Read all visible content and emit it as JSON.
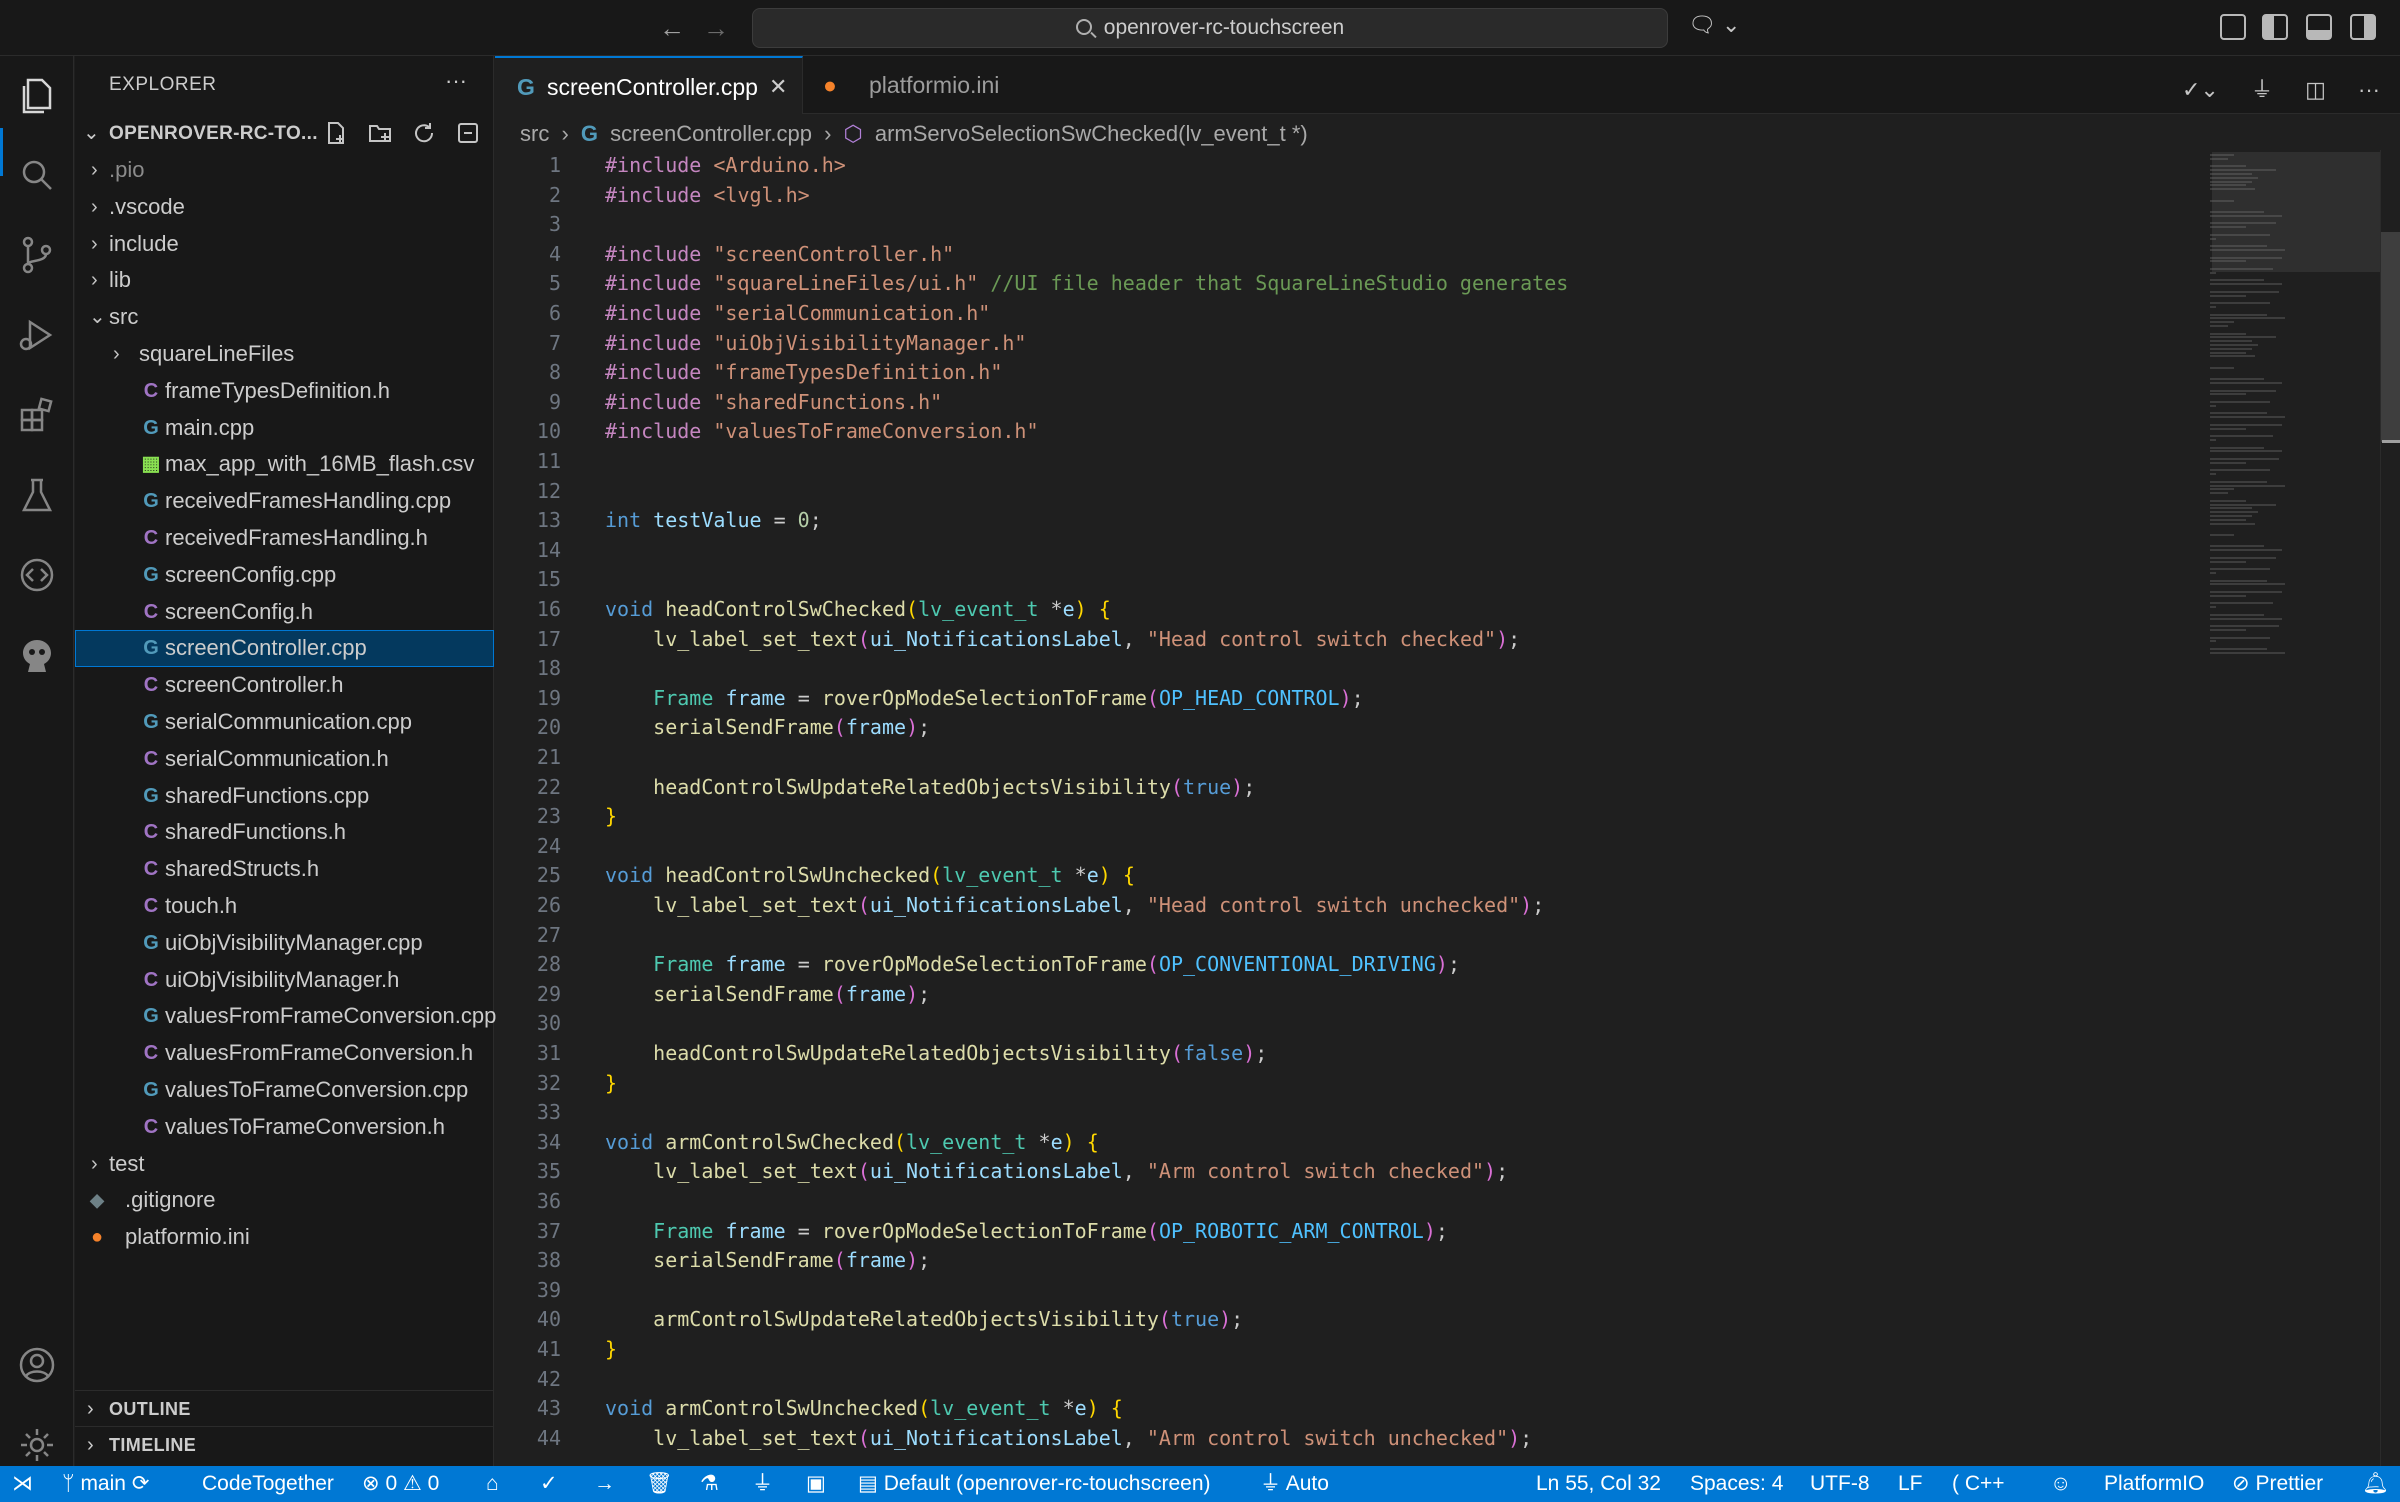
{
  "titlebar": {
    "search_text": "openrover-rc-touchscreen",
    "back_icon": "arrow-left-icon",
    "forward_icon": "arrow-right-icon"
  },
  "activity_bar": {
    "items": [
      "explorer-icon",
      "search-icon",
      "source-control-icon",
      "run-debug-icon",
      "extensions-icon",
      "testing-icon",
      "remote-icon",
      "platformio-icon"
    ],
    "bottom": [
      "account-icon",
      "settings-gear-icon"
    ]
  },
  "sidebar": {
    "title": "EXPLORER",
    "more": "···",
    "root_label": "OPENROVER-RC-TO...",
    "folders": {
      "pio": ".pio",
      "vscode": ".vscode",
      "include": "include",
      "lib": "lib",
      "src": "src",
      "squareLineFiles": "squareLineFiles",
      "test": "test"
    },
    "src_files": [
      {
        "name": "frameTypesDefinition.h",
        "icon": "C",
        "kind": "h"
      },
      {
        "name": "main.cpp",
        "icon": "G",
        "kind": "cpp"
      },
      {
        "name": "max_app_with_16MB_flash.csv",
        "icon": "▦",
        "kind": "csv"
      },
      {
        "name": "receivedFramesHandling.cpp",
        "icon": "G",
        "kind": "cpp"
      },
      {
        "name": "receivedFramesHandling.h",
        "icon": "C",
        "kind": "h"
      },
      {
        "name": "screenConfig.cpp",
        "icon": "G",
        "kind": "cpp"
      },
      {
        "name": "screenConfig.h",
        "icon": "C",
        "kind": "h"
      },
      {
        "name": "screenController.cpp",
        "icon": "G",
        "kind": "cpp"
      },
      {
        "name": "screenController.h",
        "icon": "C",
        "kind": "h"
      },
      {
        "name": "serialCommunication.cpp",
        "icon": "G",
        "kind": "cpp"
      },
      {
        "name": "serialCommunication.h",
        "icon": "C",
        "kind": "h"
      },
      {
        "name": "sharedFunctions.cpp",
        "icon": "G",
        "kind": "cpp"
      },
      {
        "name": "sharedFunctions.h",
        "icon": "C",
        "kind": "h"
      },
      {
        "name": "sharedStructs.h",
        "icon": "C",
        "kind": "h"
      },
      {
        "name": "touch.h",
        "icon": "C",
        "kind": "h"
      },
      {
        "name": "uiObjVisibilityManager.cpp",
        "icon": "G",
        "kind": "cpp"
      },
      {
        "name": "uiObjVisibilityManager.h",
        "icon": "C",
        "kind": "h"
      },
      {
        "name": "valuesFromFrameConversion.cpp",
        "icon": "G",
        "kind": "cpp"
      },
      {
        "name": "valuesFromFrameConversion.h",
        "icon": "C",
        "kind": "h"
      },
      {
        "name": "valuesToFrameConversion.cpp",
        "icon": "G",
        "kind": "cpp"
      },
      {
        "name": "valuesToFrameConversion.h",
        "icon": "C",
        "kind": "h"
      }
    ],
    "root_files": {
      "gitignore": ".gitignore",
      "platformio": "platformio.ini"
    },
    "sections": {
      "outline": "OUTLINE",
      "timeline": "TIMELINE"
    }
  },
  "tabs": [
    {
      "label": "screenController.cpp",
      "active": true
    },
    {
      "label": "platformio.ini",
      "active": false
    }
  ],
  "breadcrumb": {
    "folder": "src",
    "file": "screenController.cpp",
    "symbol": "armServoSelectionSwChecked(lv_event_t *)"
  },
  "code_lines": [
    "#include <Arduino.h>",
    "#include <lvgl.h>",
    "",
    "#include \"screenController.h\"",
    "#include \"squareLineFiles/ui.h\" //UI file header that SquareLineStudio generates",
    "#include \"serialCommunication.h\"",
    "#include \"uiObjVisibilityManager.h\"",
    "#include \"frameTypesDefinition.h\"",
    "#include \"sharedFunctions.h\"",
    "#include \"valuesToFrameConversion.h\"",
    "",
    "",
    "int testValue = 0;",
    "",
    "",
    "void headControlSwChecked(lv_event_t *e) {",
    "    lv_label_set_text(ui_NotificationsLabel, \"Head control switch checked\");",
    "",
    "    Frame frame = roverOpModeSelectionToFrame(OP_HEAD_CONTROL);",
    "    serialSendFrame(frame);",
    "",
    "    headControlSwUpdateRelatedObjectsVisibility(true);",
    "}",
    "",
    "void headControlSwUnchecked(lv_event_t *e) {",
    "    lv_label_set_text(ui_NotificationsLabel, \"Head control switch unchecked\");",
    "",
    "    Frame frame = roverOpModeSelectionToFrame(OP_CONVENTIONAL_DRIVING);",
    "    serialSendFrame(frame);",
    "",
    "    headControlSwUpdateRelatedObjectsVisibility(false);",
    "}",
    "",
    "void armControlSwChecked(lv_event_t *e) {",
    "    lv_label_set_text(ui_NotificationsLabel, \"Arm control switch checked\");",
    "",
    "    Frame frame = roverOpModeSelectionToFrame(OP_ROBOTIC_ARM_CONTROL);",
    "    serialSendFrame(frame);",
    "",
    "    armControlSwUpdateRelatedObjectsVisibility(true);",
    "}",
    "",
    "void armControlSwUnchecked(lv_event_t *e) {",
    "    lv_label_set_text(ui_NotificationsLabel, \"Arm control switch unchecked\");"
  ],
  "statusbar": {
    "remote_icon": "remote-indicator-icon",
    "branch": "main",
    "codetogether": "CodeTogether",
    "errors": "0",
    "warnings": "0",
    "project_env": "Default (openrover-rc-touchscreen)",
    "port": "Auto",
    "cursor": "Ln 55, Col 32",
    "spaces": "Spaces: 4",
    "encoding": "UTF-8",
    "eol": "LF",
    "language": "C++",
    "platformio": "PlatformIO",
    "prettier": "Prettier"
  },
  "colors": {
    "accent": "#0078d4",
    "selection": "#04395e",
    "header_icon": "#a074c4",
    "cpp_icon": "#519aba",
    "csv_icon": "#89e051",
    "platformio_icon": "#f5822a"
  }
}
